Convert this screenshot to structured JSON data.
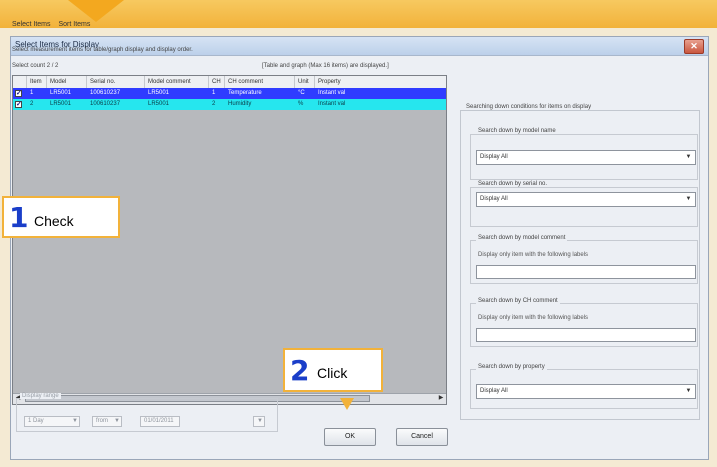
{
  "window": {
    "title": "Select Items for Display",
    "close": "✕"
  },
  "menu": [
    "Select Items",
    "Sort Items"
  ],
  "instructions": "Select measurement items for table/graph display and display order.",
  "select_count": "Select count 2 / 2",
  "select_note": "[Table and graph (Max 16 items) are displayed.]",
  "table": {
    "columns": [
      "Item",
      "Model",
      "Serial no.",
      "Model comment",
      "CH",
      "CH comment",
      "Unit",
      "Property"
    ],
    "rows": [
      {
        "checked": true,
        "item": "1",
        "model": "LR5001",
        "serial": "100610237",
        "model_comment": "LR5001",
        "ch": "1",
        "ch_comment": "Temperature",
        "unit": "°C",
        "property": "Instant val"
      },
      {
        "checked": true,
        "item": "2",
        "model": "LR5001",
        "serial": "100610237",
        "model_comment": "LR5001",
        "ch": "2",
        "ch_comment": "Humidity",
        "unit": "%",
        "property": "Instant val"
      }
    ]
  },
  "callouts": {
    "check": {
      "number": "1",
      "word": "Check"
    },
    "click": {
      "number": "2",
      "word": "Click"
    }
  },
  "display_range": {
    "label": "Display range",
    "unit": "1 Day",
    "from": "from",
    "date": "01/01/2011"
  },
  "buttons": {
    "ok": "OK",
    "cancel": "Cancel"
  },
  "filters": {
    "title": "Searching down conditions for items on display",
    "model_name": {
      "label": "Search down by model name",
      "value": "Display All"
    },
    "serial_no": {
      "label": "Search down by serial no.",
      "value": "Display All"
    },
    "model_comment": {
      "label": "Search down by model comment",
      "hint": "Display only item with the following labels"
    },
    "ch_comment": {
      "label": "Search down by CH comment",
      "hint": "Display only item with the following labels"
    },
    "property": {
      "label": "Search down by property",
      "value": "Display All"
    }
  },
  "colors": {
    "selected_row": "#2f3cff",
    "second_row": "#26e6ee",
    "callout_border": "#f2b23a",
    "callout_number": "#1a3ec9"
  }
}
